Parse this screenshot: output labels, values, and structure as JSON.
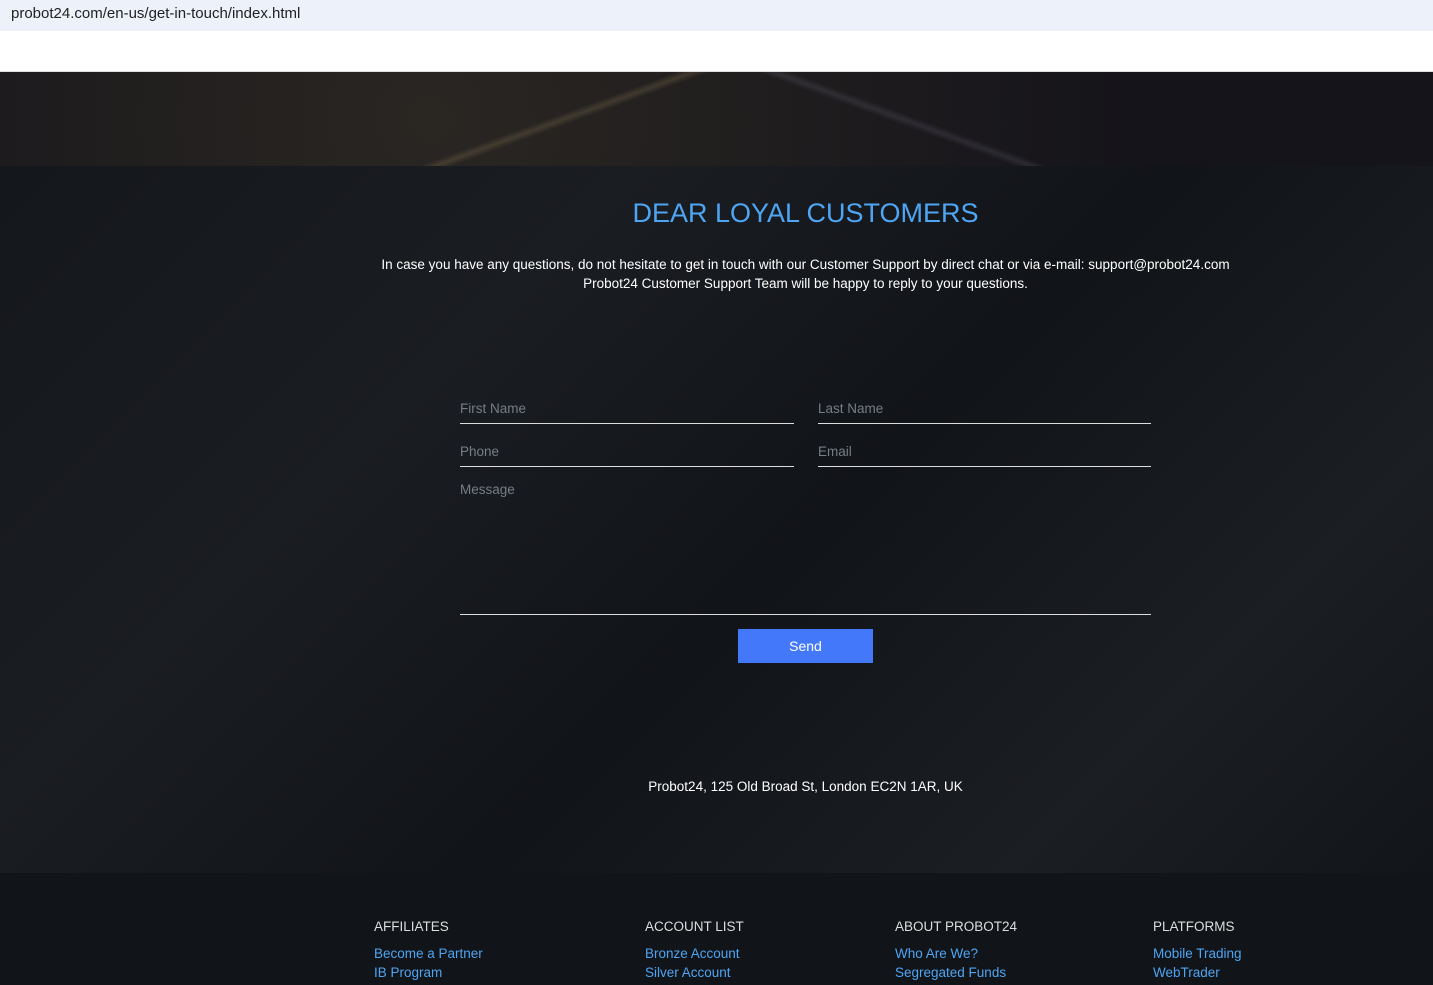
{
  "browser": {
    "url": "probot24.com/en-us/get-in-touch/index.html"
  },
  "main": {
    "title": "DEAR LOYAL CUSTOMERS",
    "intro_line1": "In case you have any questions, do not hesitate to get in touch with our Customer Support by direct chat or via e-mail: support@probot24.com",
    "intro_line2": "Probot24 Customer Support Team will be happy to reply to your questions.",
    "form": {
      "first_name": "First Name",
      "last_name": "Last Name",
      "phone": "Phone",
      "email": "Email",
      "message": "Message",
      "send": "Send"
    },
    "address": "Probot24, 125 Old Broad St, London EC2N 1AR, UK"
  },
  "footer": {
    "columns": [
      {
        "title": "AFFILIATES",
        "links": [
          "Become a Partner",
          "IB Program"
        ]
      },
      {
        "title": "ACCOUNT LIST",
        "links": [
          "Bronze Account",
          "Silver Account"
        ]
      },
      {
        "title": "ABOUT PROBOT24",
        "links": [
          "Who Are We?",
          "Segregated Funds"
        ]
      },
      {
        "title": "PLATFORMS",
        "links": [
          "Mobile Trading",
          "WebTrader"
        ]
      }
    ]
  }
}
